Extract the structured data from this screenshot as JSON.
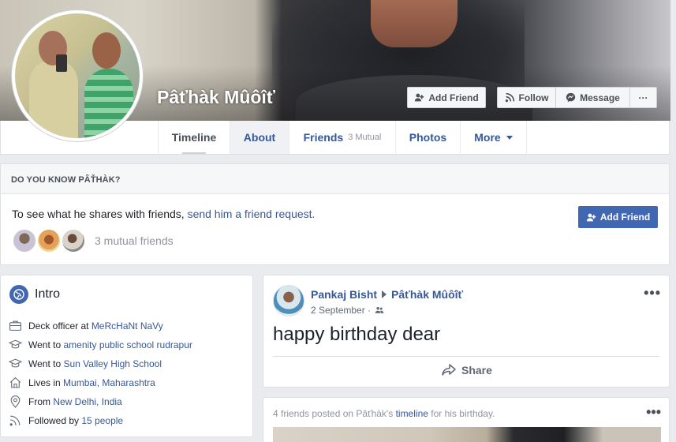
{
  "profile": {
    "name": "Pâťhàk Mûôîť"
  },
  "cover_buttons": {
    "add_friend": "Add Friend",
    "follow": "Follow",
    "message": "Message",
    "more": "···"
  },
  "tabs": {
    "timeline": "Timeline",
    "about": "About",
    "friends": "Friends",
    "friends_mutual": "3 Mutual",
    "photos": "Photos",
    "more": "More"
  },
  "know_card": {
    "heading": "DO YOU KNOW PÂŤHÀK?",
    "text_prefix": "To see what he shares with friends, ",
    "text_link": "send him a friend request.",
    "button": "Add Friend",
    "mutual": "3 mutual friends"
  },
  "intro": {
    "title": "Intro",
    "items": [
      {
        "prefix": "Deck officer at ",
        "link": "MeRcHaNt NaVy",
        "icon": "briefcase-icon"
      },
      {
        "prefix": "Went to ",
        "link": "amenity public school rudrapur",
        "icon": "graduation-cap-icon"
      },
      {
        "prefix": "Went to ",
        "link": "Sun Valley High School",
        "icon": "graduation-cap-icon"
      },
      {
        "prefix": "Lives in ",
        "link": "Mumbai, Maharashtra",
        "icon": "home-icon"
      },
      {
        "prefix": "From ",
        "link": "New Delhi, India",
        "icon": "location-pin-icon"
      },
      {
        "prefix": "Followed by ",
        "link": "15 people",
        "icon": "rss-icon"
      }
    ]
  },
  "post": {
    "author": "Pankaj Bisht",
    "target": "Pâťhàk Mûôîť",
    "date": "2 September ·",
    "body": "happy birthday dear",
    "share": "Share",
    "dots": "•••"
  },
  "birthday_card": {
    "text_prefix": "4 friends posted on Pâťhàk's ",
    "text_link": "timeline",
    "text_suffix": " for his birthday.",
    "dots": "•••"
  },
  "colors": {
    "brand": "#4267b2",
    "link": "#365899",
    "background": "#e9ebee"
  }
}
